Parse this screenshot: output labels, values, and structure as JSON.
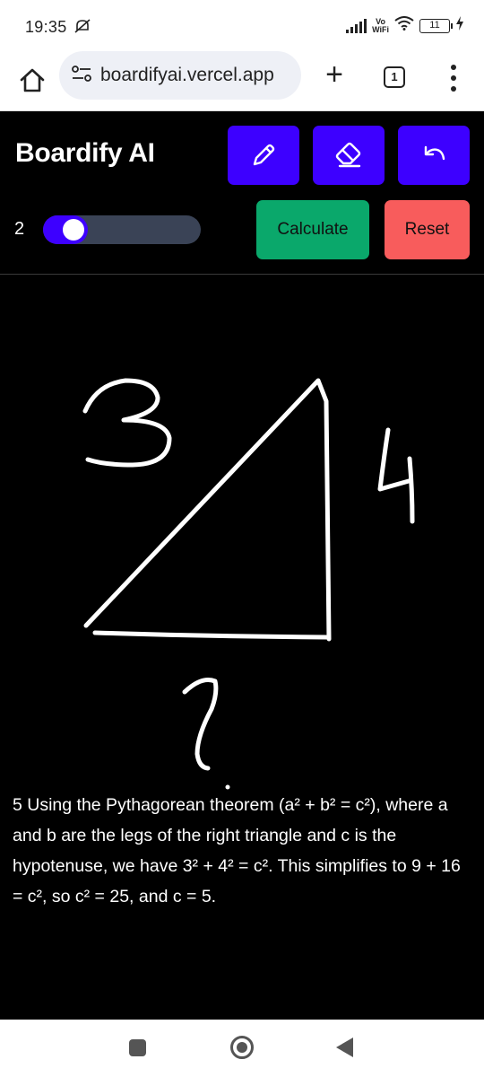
{
  "status_bar": {
    "time": "19:35",
    "network_label_top": "Vo",
    "network_label_bottom": "WiFi",
    "battery_level": "11"
  },
  "browser": {
    "url": "boardifyai.vercel.app",
    "tab_count": "1",
    "new_tab_symbol": "+"
  },
  "app": {
    "title": "Boardify AI",
    "brush_size": "2",
    "brush_slider_fraction": 0.08,
    "calculate_label": "Calculate",
    "reset_label": "Reset",
    "tools": [
      "pencil-icon",
      "eraser-icon",
      "undo-icon"
    ],
    "accent_color": "#3d00ff",
    "calculate_color": "#0aa86b",
    "reset_color": "#f85c5c"
  },
  "canvas": {
    "handwriting_labels": [
      "3",
      "4",
      "?"
    ],
    "result_text": "5 Using the Pythagorean theorem (a² + b² = c²), where a and b are the legs of the right triangle and c is the hypotenuse, we have 3² + 4² = c². This simplifies to 9 + 16 = c², so c² = 25, and c = 5."
  }
}
